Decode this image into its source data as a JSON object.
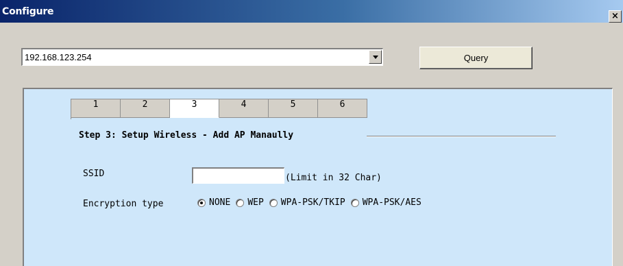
{
  "window": {
    "title": "Configure",
    "close_label": "×"
  },
  "device_select": {
    "value": "192.168.123.254"
  },
  "query_button": {
    "label": "Query"
  },
  "steps": {
    "tabs": [
      "1",
      "2",
      "3",
      "4",
      "5",
      "6"
    ],
    "active_index": 2,
    "title": "Step 3: Setup Wireless - Add AP Manaully"
  },
  "ssid": {
    "label": "SSID",
    "value": "",
    "hint": "(Limit in 32 Char)"
  },
  "encryption": {
    "label": "Encryption type",
    "options": [
      "NONE",
      "WEP",
      "WPA-PSK/TKIP",
      "WPA-PSK/AES"
    ],
    "selected": "NONE"
  }
}
